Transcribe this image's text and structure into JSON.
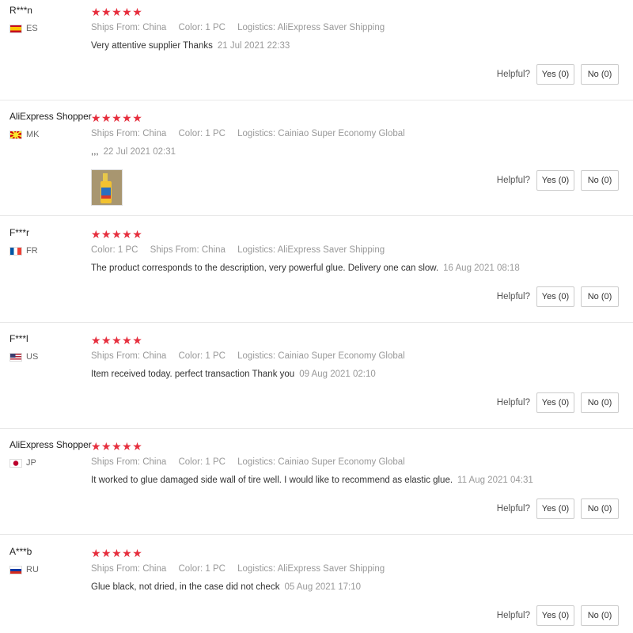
{
  "reviews": [
    {
      "user": "R***n",
      "country": "ES",
      "flag": "spain-flag-icon",
      "stars": "★★★★★",
      "meta": [
        [
          "Ships From:",
          "China"
        ],
        [
          "Color:",
          "1 PC"
        ],
        [
          "Logistics:",
          "AliExpress Saver Shipping"
        ]
      ],
      "text": "Very attentive supplier Thanks",
      "date": "21 Jul 2021 22:33",
      "helpful_label": "Helpful?",
      "yes": "Yes (0)",
      "no": "No (0)"
    },
    {
      "user": "AliExpress Shopper",
      "country": "MK",
      "flag": "macedonia-flag-icon",
      "stars": "★★★★★",
      "meta": [
        [
          "Ships From:",
          "China"
        ],
        [
          "Color:",
          "1 PC"
        ],
        [
          "Logistics:",
          "Cainiao Super Economy Global"
        ]
      ],
      "text": ",,,",
      "date": "22 Jul 2021 02:31",
      "helpful_label": "Helpful?",
      "yes": "Yes (0)",
      "no": "No (0)"
    },
    {
      "user": "F***r",
      "country": "FR",
      "flag": "france-flag-icon",
      "stars": "★★★★★",
      "meta": [
        [
          "Color:",
          "1 PC"
        ],
        [
          "Ships From:",
          "China"
        ],
        [
          "Logistics:",
          "AliExpress Saver Shipping"
        ]
      ],
      "text": "The product corresponds to the description, very powerful glue. Delivery one can slow.",
      "date": "16 Aug 2021 08:18",
      "helpful_label": "Helpful?",
      "yes": "Yes (0)",
      "no": "No (0)"
    },
    {
      "user": "F***l",
      "country": "US",
      "flag": "usa-flag-icon",
      "stars": "★★★★★",
      "meta": [
        [
          "Ships From:",
          "China"
        ],
        [
          "Color:",
          "1 PC"
        ],
        [
          "Logistics:",
          "Cainiao Super Economy Global"
        ]
      ],
      "text": "Item received today. perfect transaction Thank you",
      "date": "09 Aug 2021 02:10",
      "helpful_label": "Helpful?",
      "yes": "Yes (0)",
      "no": "No (0)"
    },
    {
      "user": "AliExpress Shopper",
      "country": "JP",
      "flag": "japan-flag-icon",
      "stars": "★★★★★",
      "meta": [
        [
          "Ships From:",
          "China"
        ],
        [
          "Color:",
          "1 PC"
        ],
        [
          "Logistics:",
          "Cainiao Super Economy Global"
        ]
      ],
      "text": "It worked to glue damaged side wall of tire well. I would like to recommend as elastic glue.",
      "date": "11 Aug 2021 04:31",
      "helpful_label": "Helpful?",
      "yes": "Yes (0)",
      "no": "No (0)"
    },
    {
      "user": "A***b",
      "country": "RU",
      "flag": "russia-flag-icon",
      "stars": "★★★★★",
      "meta": [
        [
          "Ships From:",
          "China"
        ],
        [
          "Color:",
          "1 PC"
        ],
        [
          "Logistics:",
          "AliExpress Saver Shipping"
        ]
      ],
      "text": "Glue black, not dried, in the case did not check",
      "date": "05 Aug 2021 17:10",
      "helpful_label": "Helpful?",
      "yes": "Yes (0)",
      "no": "No (0)"
    }
  ]
}
